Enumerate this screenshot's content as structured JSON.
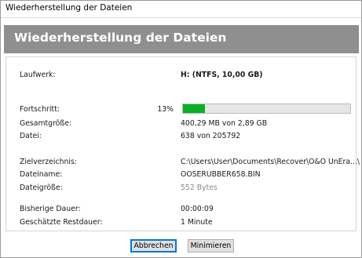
{
  "window": {
    "title": "Wiederherstellung der Dateien"
  },
  "header": {
    "title": "Wiederherstellung der Dateien"
  },
  "drive": {
    "label": "Laufwerk:",
    "value": "H: (NTFS, 10,00 GB)"
  },
  "progress": {
    "label": "Fortschritt:",
    "percent_text": "13%",
    "fraction": 0.13,
    "fill_color": "#06b025"
  },
  "total_size": {
    "label": "Gesamtgröße:",
    "value": "400,29 MB von 2,89 GB"
  },
  "file_count": {
    "label": "Datei:",
    "value": "638 von 205792"
  },
  "target_dir": {
    "label": "Zielverzeichnis:",
    "value": "C:\\Users\\User\\Documents\\Recover\\O&O UnEra...\\"
  },
  "file_name": {
    "label": "Dateiname:",
    "value": "OOSERUBBER658.BIN"
  },
  "file_size": {
    "label": "Dateigröße:",
    "value": "552 Bytes"
  },
  "elapsed": {
    "label": "Bisherige Dauer:",
    "value": "00:00:09"
  },
  "remaining": {
    "label": "Geschätzte Restdauer:",
    "value": "1 Minute"
  },
  "buttons": {
    "cancel": "Abbrechen",
    "minimize": "Minimieren"
  },
  "colors": {
    "header_band": "#8f8f8f",
    "accent_focus": "#0078d7"
  }
}
